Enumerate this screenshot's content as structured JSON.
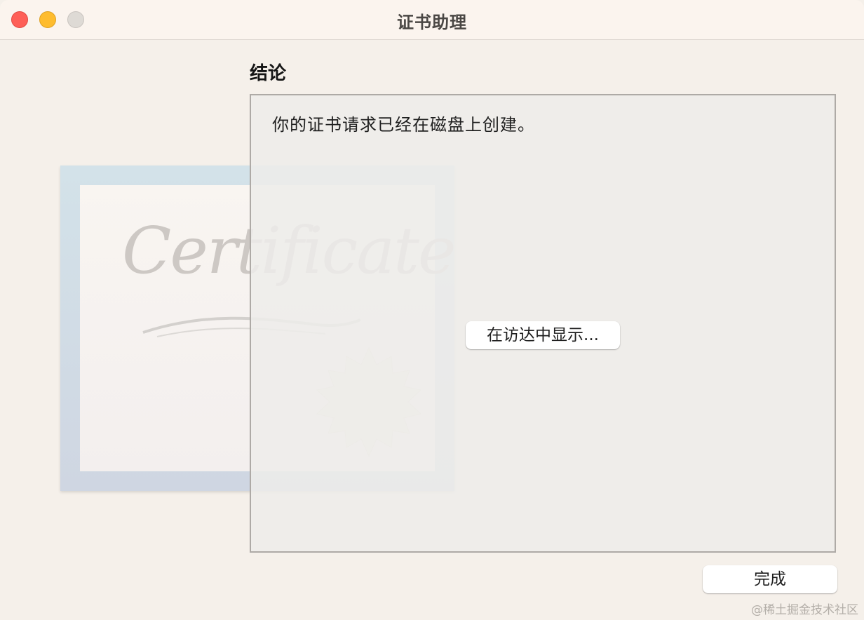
{
  "window": {
    "title": "证书助理"
  },
  "illustration": {
    "script_text": "Certificate"
  },
  "main": {
    "heading": "结论",
    "message": "你的证书请求已经在磁盘上创建。",
    "show_in_finder_label": "在访达中显示..."
  },
  "footer": {
    "done_label": "完成"
  },
  "watermark": "@稀土掘金技术社区",
  "colors": {
    "close": "#fe5f57",
    "minimize": "#febc2e",
    "zoom": "#dedad5",
    "background": "#f5f0ea"
  }
}
